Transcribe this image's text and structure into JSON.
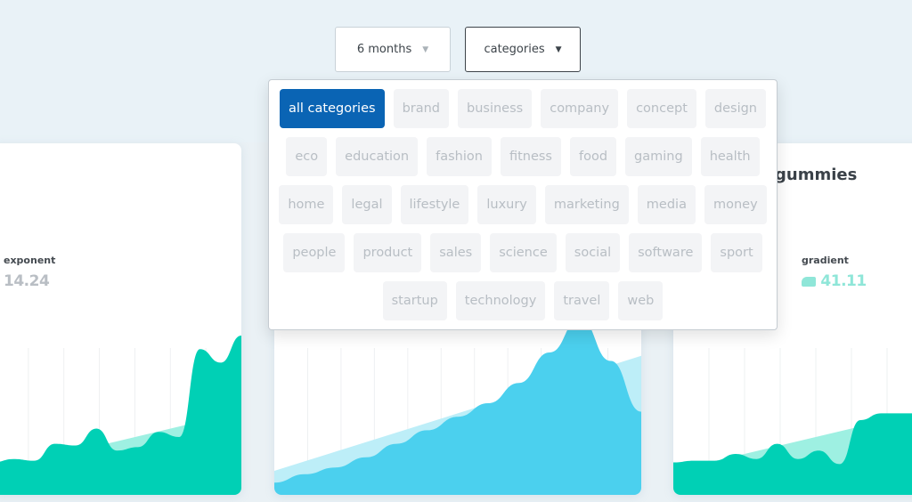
{
  "filters": {
    "period": "6 months",
    "category": "categories"
  },
  "dropdown": {
    "rows": [
      [
        "all categories",
        "brand",
        "business",
        "company",
        "concept",
        "design"
      ],
      [
        "eco",
        "education",
        "fashion",
        "fitness",
        "food",
        "gaming",
        "health"
      ],
      [
        "home",
        "legal",
        "lifestyle",
        "luxury",
        "marketing",
        "media",
        "money"
      ],
      [
        "people",
        "product",
        "sales",
        "science",
        "social",
        "software",
        "sport"
      ],
      [
        "startup",
        "technology",
        "travel",
        "web"
      ]
    ],
    "selected": "all categories"
  },
  "cards": [
    {
      "metric_label": "exponent",
      "metric_value": "14.24",
      "value_color": "#b9bec4",
      "area_color": "#00d0b5",
      "trend_color": "#9ef0e2",
      "series": [
        15,
        17,
        16,
        26,
        25,
        35,
        22,
        24,
        33,
        30,
        82,
        74,
        90
      ]
    },
    {
      "area_color": "#4bd0ee",
      "trend_color": "#bdeef8",
      "series": [
        3,
        8,
        12,
        18,
        26,
        34,
        42,
        50,
        62,
        80,
        100,
        75,
        45
      ]
    },
    {
      "title": "gummies",
      "metric_label": "gradient",
      "metric_value": "41.11",
      "value_color": "#8fe6d8",
      "area_color": "#00d0b5",
      "trend_color": "#9ef0e2",
      "series": [
        15,
        16,
        16,
        20,
        17,
        26,
        17,
        22,
        14,
        40,
        44,
        44,
        44
      ]
    }
  ]
}
